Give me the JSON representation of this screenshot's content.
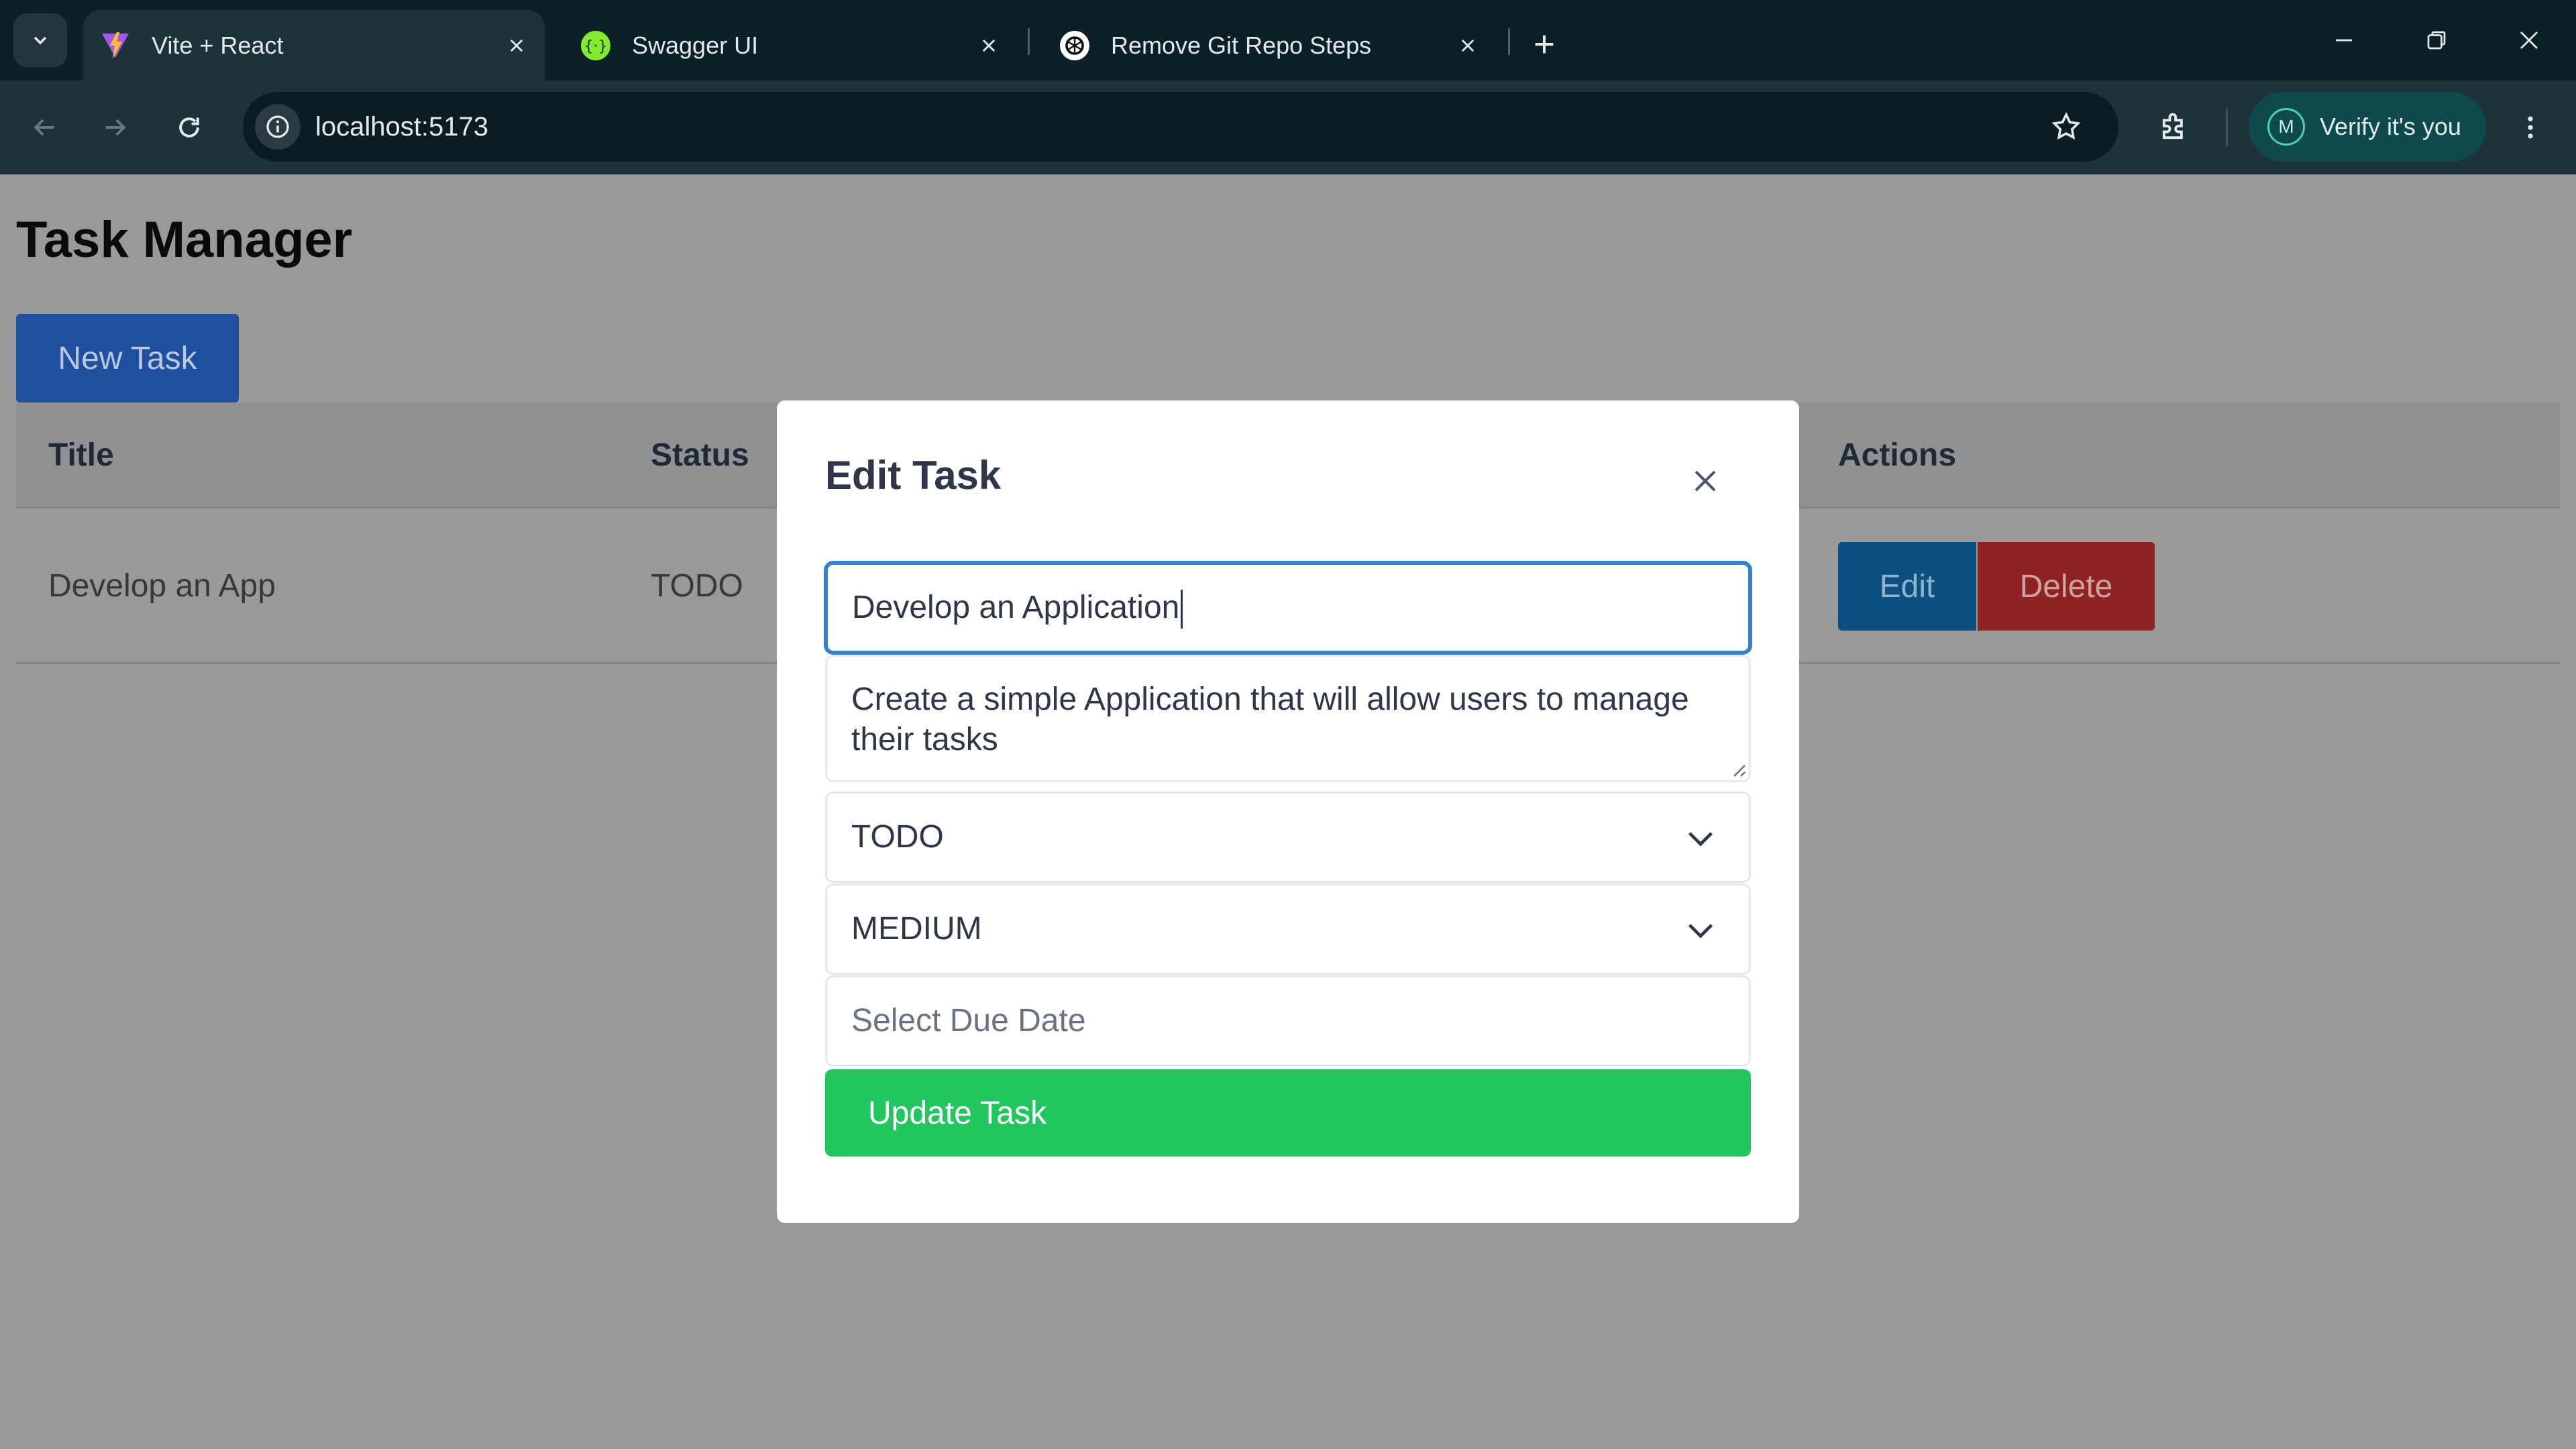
{
  "browser": {
    "tabs": [
      {
        "title": "Vite + React",
        "icon": "vite-icon",
        "active": true
      },
      {
        "title": "Swagger UI",
        "icon": "swagger-icon",
        "active": false
      },
      {
        "title": "Remove Git Repo Steps",
        "icon": "chatgpt-icon",
        "active": false
      }
    ],
    "url": "localhost:5173",
    "profile_initial": "M",
    "profile_label": "Verify it's you"
  },
  "app": {
    "title": "Task Manager",
    "new_task_label": "New Task",
    "table": {
      "headers": {
        "title": "Title",
        "status": "Status",
        "actions": "Actions"
      },
      "rows": [
        {
          "title": "Develop an App",
          "status": "TODO"
        }
      ],
      "edit_label": "Edit",
      "delete_label": "Delete"
    }
  },
  "modal": {
    "title": "Edit Task",
    "title_value": "Develop an Application",
    "description_value": "Create a simple Application that will allow users to manage their tasks",
    "status_value": "TODO",
    "priority_value": "MEDIUM",
    "due_date_placeholder": "Select Due Date",
    "submit_label": "Update Task"
  },
  "colors": {
    "primary": "#1f4f9f",
    "edit": "#0b5080",
    "delete": "#8f2323",
    "update": "#22c55e",
    "focus": "#3182ce"
  }
}
